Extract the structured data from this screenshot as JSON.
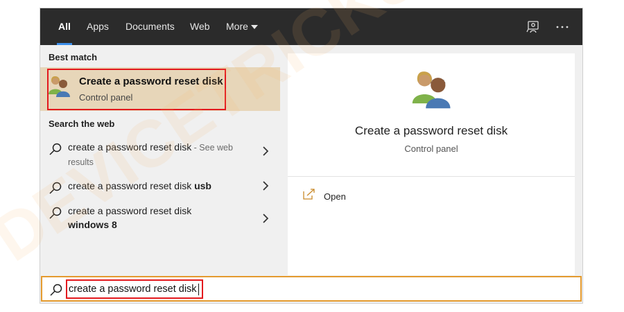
{
  "tabs": [
    {
      "label": "All",
      "active": true
    },
    {
      "label": "Apps"
    },
    {
      "label": "Documents"
    },
    {
      "label": "Web"
    },
    {
      "label": "More"
    }
  ],
  "topbar_icons": [
    "feedback-icon",
    "more-options-icon"
  ],
  "best_match": {
    "heading": "Best match",
    "title": "Create a password reset disk",
    "subtitle": "Control panel",
    "icon": "users-icon"
  },
  "search_web": {
    "heading": "Search the web",
    "items": [
      {
        "main": "create a password reset disk",
        "muted": " - See web",
        "line2": "results"
      },
      {
        "main": "create a password reset disk ",
        "bold": "usb"
      },
      {
        "main": "create a password reset disk",
        "bold_line2": "windows 8"
      }
    ]
  },
  "preview": {
    "title": "Create a password reset disk",
    "subtitle": "Control panel",
    "actions": [
      {
        "label": "Open",
        "icon": "open-icon"
      }
    ]
  },
  "search": {
    "value": "create a password reset disk",
    "icon": "search-icon"
  },
  "watermark_text": "DEVICETRICKS",
  "colors": {
    "topbar": "#2b2b2b",
    "accent": "#3b8eea",
    "selection": "#e7d6b9",
    "highlight": "#e3191e",
    "search_border": "#e49a2e"
  }
}
